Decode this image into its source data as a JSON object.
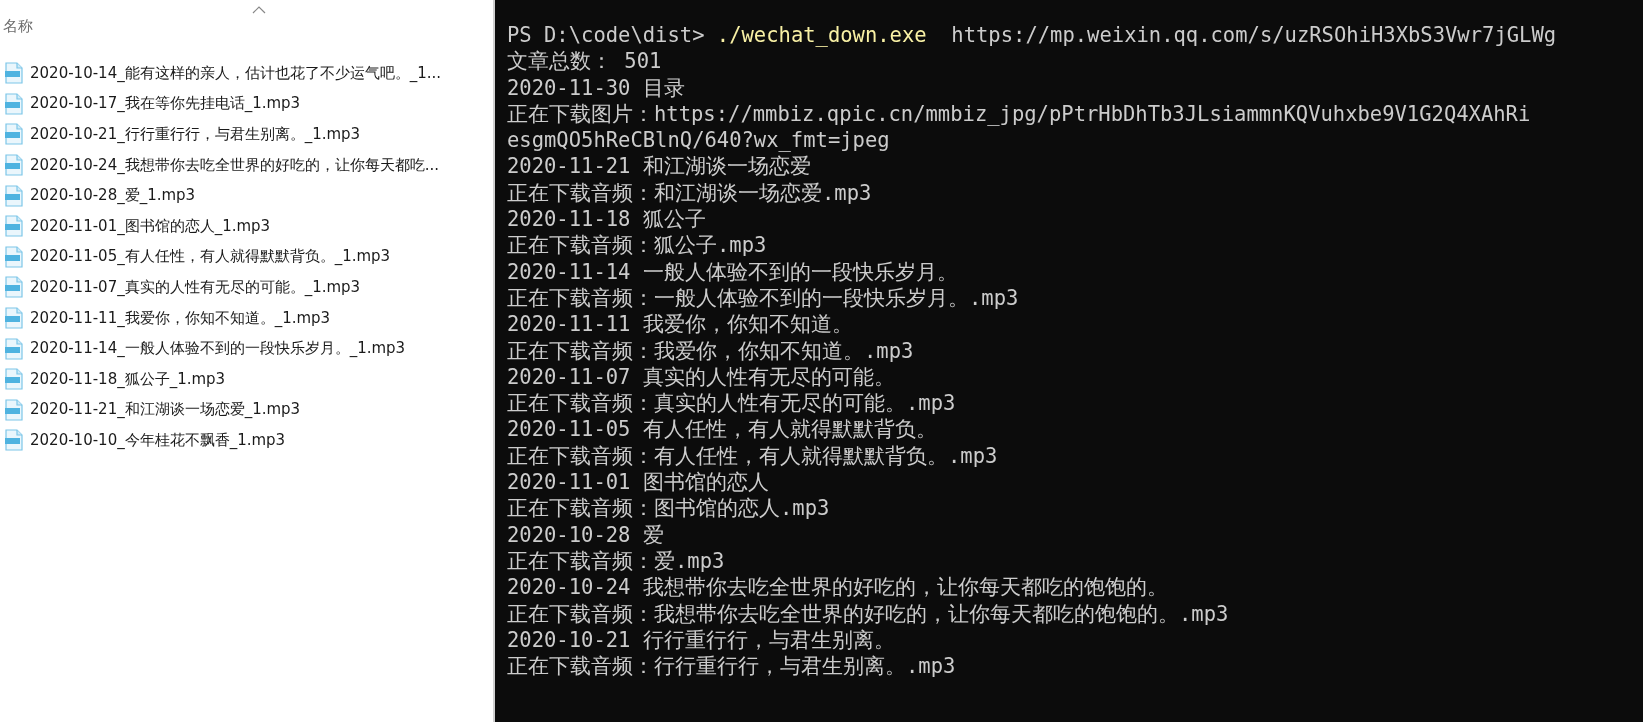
{
  "explorer": {
    "column_header": "名称",
    "files": [
      "2020-10-14_能有这样的亲人，估计也花了不少运气吧。_1...",
      "2020-10-17_我在等你先挂电话_1.mp3",
      "2020-10-21_行行重行行，与君生别离。_1.mp3",
      "2020-10-24_我想带你去吃全世界的好吃的，让你每天都吃...",
      "2020-10-28_爱_1.mp3",
      "2020-11-01_图书馆的恋人_1.mp3",
      "2020-11-05_有人任性，有人就得默默背负。_1.mp3",
      "2020-11-07_真实的人性有无尽的可能。_1.mp3",
      "2020-11-11_我爱你，你知不知道。_1.mp3",
      "2020-11-14_一般人体验不到的一段快乐岁月。_1.mp3",
      "2020-11-18_狐公子_1.mp3",
      "2020-11-21_和江湖谈一场恋爱_1.mp3",
      "2020-10-10_今年桂花不飘香_1.mp3"
    ]
  },
  "terminal": {
    "command_line": {
      "prompt": "PS D:\\code\\dist>",
      "command": "./wechat_down.exe",
      "argument": "https://mp.weixin.qq.com/s/uzRSOhiH3XbS3Vwr7jGLWg"
    },
    "output": [
      "文章总数： 501",
      "2020-11-30 目录",
      "正在下载图片：https://mmbiz.qpic.cn/mmbiz_jpg/pPtrHbDhTb3JLsiammnKQVuhxbe9V1G2Q4XAhRi",
      "esgmQO5hReCBlnQ/640?wx_fmt=jpeg",
      "2020-11-21 和江湖谈一场恋爱",
      "正在下载音频：和江湖谈一场恋爱.mp3",
      "2020-11-18 狐公子",
      "正在下载音频：狐公子.mp3",
      "2020-11-14 一般人体验不到的一段快乐岁月。",
      "正在下载音频：一般人体验不到的一段快乐岁月。.mp3",
      "2020-11-11 我爱你，你知不知道。",
      "正在下载音频：我爱你，你知不知道。.mp3",
      "2020-11-07 真实的人性有无尽的可能。",
      "正在下载音频：真实的人性有无尽的可能。.mp3",
      "2020-11-05 有人任性，有人就得默默背负。",
      "正在下载音频：有人任性，有人就得默默背负。.mp3",
      "2020-11-01 图书馆的恋人",
      "正在下载音频：图书馆的恋人.mp3",
      "2020-10-28 爱",
      "正在下载音频：爱.mp3",
      "2020-10-24 我想带你去吃全世界的好吃的，让你每天都吃的饱饱的。",
      "正在下载音频：我想带你去吃全世界的好吃的，让你每天都吃的饱饱的。.mp3",
      "2020-10-21 行行重行行，与君生别离。",
      "正在下载音频：行行重行行，与君生别离。.mp3"
    ]
  }
}
